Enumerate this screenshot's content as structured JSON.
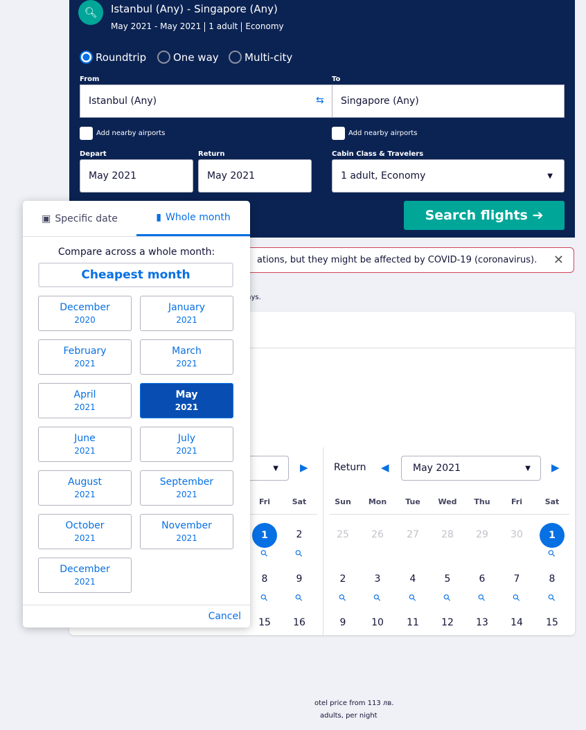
{
  "summary": {
    "title": "Istanbul (Any) - Singapore (Any)",
    "dates": "May 2021 - May 2021",
    "travelers": "1 adult",
    "cabin": "Economy"
  },
  "trip_types": [
    {
      "label": "Roundtrip",
      "selected": true
    },
    {
      "label": "One way",
      "selected": false
    },
    {
      "label": "Multi-city",
      "selected": false
    }
  ],
  "form": {
    "from_label": "From",
    "from_value": "Istanbul (Any)",
    "to_label": "To",
    "to_value": "Singapore (Any)",
    "nearby": "Add nearby airports",
    "depart_label": "Depart",
    "depart_value": "May 2021",
    "return_label": "Return",
    "return_value": "May 2021",
    "cabin_label": "Cabin Class & Travelers",
    "cabin_value": "1 adult, Economy",
    "search": "Search flights"
  },
  "alert": {
    "text": "ations, but they might be affected by COVID-19 (coronavirus)."
  },
  "note": "days.",
  "hotel": {
    "line1": "otel price from 113 лв.",
    "line2": "adults, per night"
  },
  "popup": {
    "tab_specific": "Specific date",
    "tab_month": "Whole month",
    "compare": "Compare across a whole month:",
    "cheapest": "Cheapest month",
    "cancel": "Cancel",
    "months": [
      {
        "m": "December",
        "y": "2020"
      },
      {
        "m": "January",
        "y": "2021"
      },
      {
        "m": "February",
        "y": "2021"
      },
      {
        "m": "March",
        "y": "2021"
      },
      {
        "m": "April",
        "y": "2021"
      },
      {
        "m": "May",
        "y": "2021",
        "selected": true
      },
      {
        "m": "June",
        "y": "2021"
      },
      {
        "m": "July",
        "y": "2021"
      },
      {
        "m": "August",
        "y": "2021"
      },
      {
        "m": "September",
        "y": "2021"
      },
      {
        "m": "October",
        "y": "2021"
      },
      {
        "m": "November",
        "y": "2021"
      },
      {
        "m": "December",
        "y": "2021"
      }
    ]
  },
  "cal_left": {
    "days": [
      "Fri",
      "Sat"
    ],
    "rows": [
      [
        "1",
        "2"
      ],
      [
        "8",
        "9"
      ],
      [
        "15",
        "16"
      ]
    ]
  },
  "cal_right": {
    "label": "Return",
    "month": "May 2021",
    "days": [
      "Sun",
      "Mon",
      "Tue",
      "Wed",
      "Thu",
      "Fri",
      "Sat"
    ],
    "rows": [
      [
        "25",
        "26",
        "27",
        "28",
        "29",
        "30",
        "1"
      ],
      [
        "2",
        "3",
        "4",
        "5",
        "6",
        "7",
        "8"
      ],
      [
        "9",
        "10",
        "11",
        "12",
        "13",
        "14",
        "15"
      ]
    ]
  }
}
